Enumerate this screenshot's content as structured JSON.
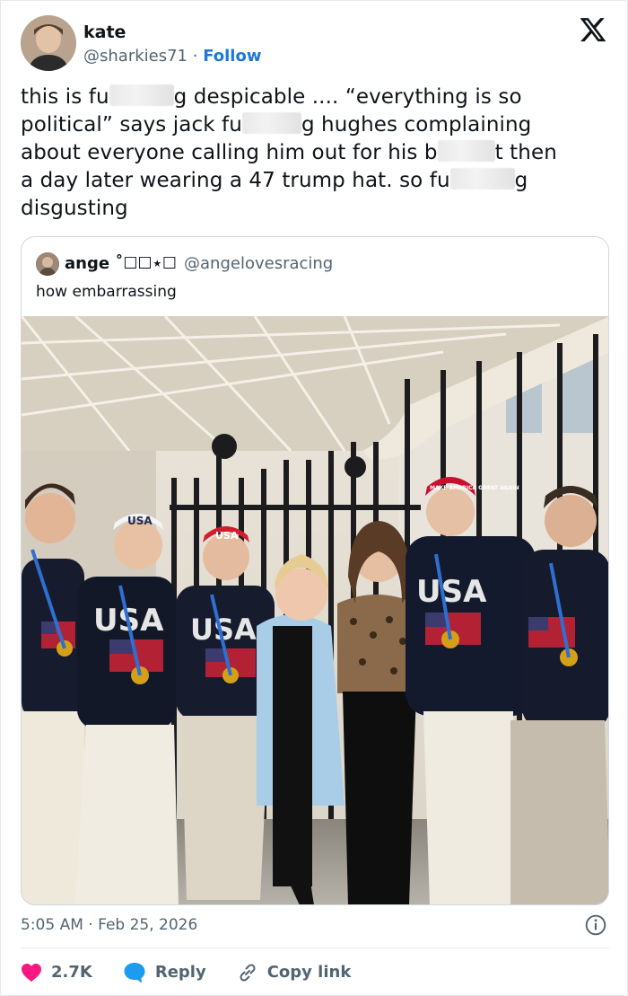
{
  "author": {
    "name": "kate",
    "handle": "@sharkies71",
    "separator": "·",
    "follow_label": "Follow"
  },
  "tweet": {
    "line1_a": "this is fu",
    "line1_b": "g despicable ....  “everything is so",
    "line2_a": "political” says jack fu",
    "line2_b": "g hughes complaining",
    "line3_a": "about everyone calling him out for his b",
    "line3_b": "t then",
    "line4_a": "a day later wearing a 47 trump hat. so fu",
    "line4_b": "g",
    "line5": "disgusting"
  },
  "quoted": {
    "name": "ange ˚",
    "name_symbols": "☐☐⋆☐",
    "handle": "@angelovesracing",
    "text": "how embarrassing"
  },
  "photo": {
    "cap_text_1": "USA",
    "cap_text_2": "USA",
    "cap_text_3": "MAKE AMERICA GREAT AGAIN",
    "shirt_text": "USA"
  },
  "meta": {
    "time": "5:05 AM",
    "separator": "·",
    "date": "Feb 25, 2026"
  },
  "actions": {
    "likes": "2.7K",
    "reply_label": "Reply",
    "copy_label": "Copy link"
  },
  "colors": {
    "like": "#f91880",
    "reply": "#1d9bf0",
    "follow": "#1d78d6",
    "muted": "#536471"
  },
  "icons": [
    "x-logo-icon",
    "info-icon",
    "heart-icon",
    "reply-bubble-icon",
    "link-icon"
  ]
}
